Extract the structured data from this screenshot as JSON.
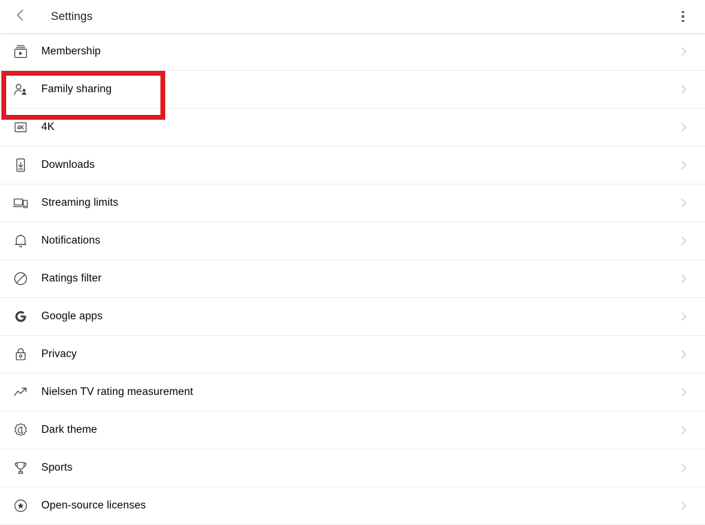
{
  "header": {
    "title": "Settings",
    "back_icon": "chevron-left-icon",
    "overflow_icon": "more-vertical-icon"
  },
  "settings": {
    "chevron_icon": "chevron-right-icon",
    "rows": [
      {
        "label": "Membership",
        "icon": "membership-card-icon"
      },
      {
        "label": "Family sharing",
        "icon": "family-people-icon"
      },
      {
        "label": "4K",
        "icon": "four-k-badge-icon"
      },
      {
        "label": "Downloads",
        "icon": "phone-download-icon"
      },
      {
        "label": "Streaming limits",
        "icon": "devices-icon"
      },
      {
        "label": "Notifications",
        "icon": "bell-icon"
      },
      {
        "label": "Ratings filter",
        "icon": "block-circle-icon"
      },
      {
        "label": "Google apps",
        "icon": "google-g-icon"
      },
      {
        "label": "Privacy",
        "icon": "lock-icon"
      },
      {
        "label": "Nielsen TV rating measurement",
        "icon": "trending-up-icon"
      },
      {
        "label": "Dark theme",
        "icon": "brightness-moon-icon"
      },
      {
        "label": "Sports",
        "icon": "trophy-icon"
      },
      {
        "label": "Open-source licenses",
        "icon": "star-circle-icon"
      }
    ]
  },
  "annotation": {
    "target_label": "Family sharing",
    "color": "#e01b22"
  }
}
